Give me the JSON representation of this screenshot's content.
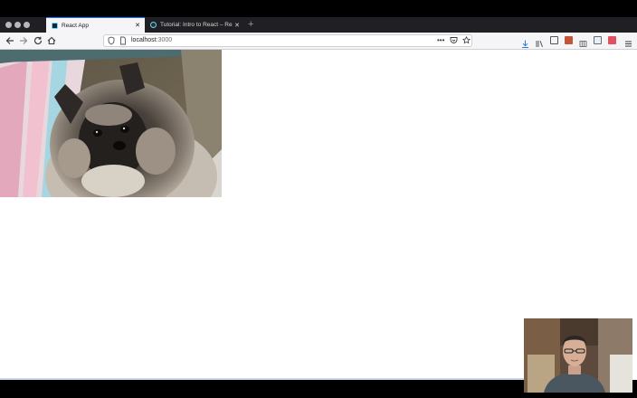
{
  "browser": {
    "tabs": [
      {
        "label": "React App",
        "active": true
      },
      {
        "label": "Tutorial: Intro to React – React",
        "active": false
      }
    ],
    "new_tab_symbol": "+",
    "close_symbol": "✕",
    "url": {
      "host": "localhost",
      "port": ":3000"
    },
    "more_symbol": "•••",
    "icons": [
      "back-arrow-icon",
      "forward-arrow-icon",
      "reload-icon",
      "home-icon",
      "shield-icon",
      "page-icon",
      "pocket-icon",
      "bookmark-star-icon",
      "download-icon",
      "library-icon",
      "sidebar-icon",
      "extension-icon",
      "container-icon",
      "extension-icon",
      "extension-icon",
      "menu-icon"
    ]
  },
  "page": {
    "image": {
      "subject": "puppy-photo",
      "alt": "puppy"
    }
  },
  "overlay": {
    "webcam": {
      "subject": "presenter-webcam"
    }
  },
  "colors": {
    "accent": "#0a84ff",
    "tabbar": "#202024",
    "toolbar": "#f5f5f7"
  }
}
